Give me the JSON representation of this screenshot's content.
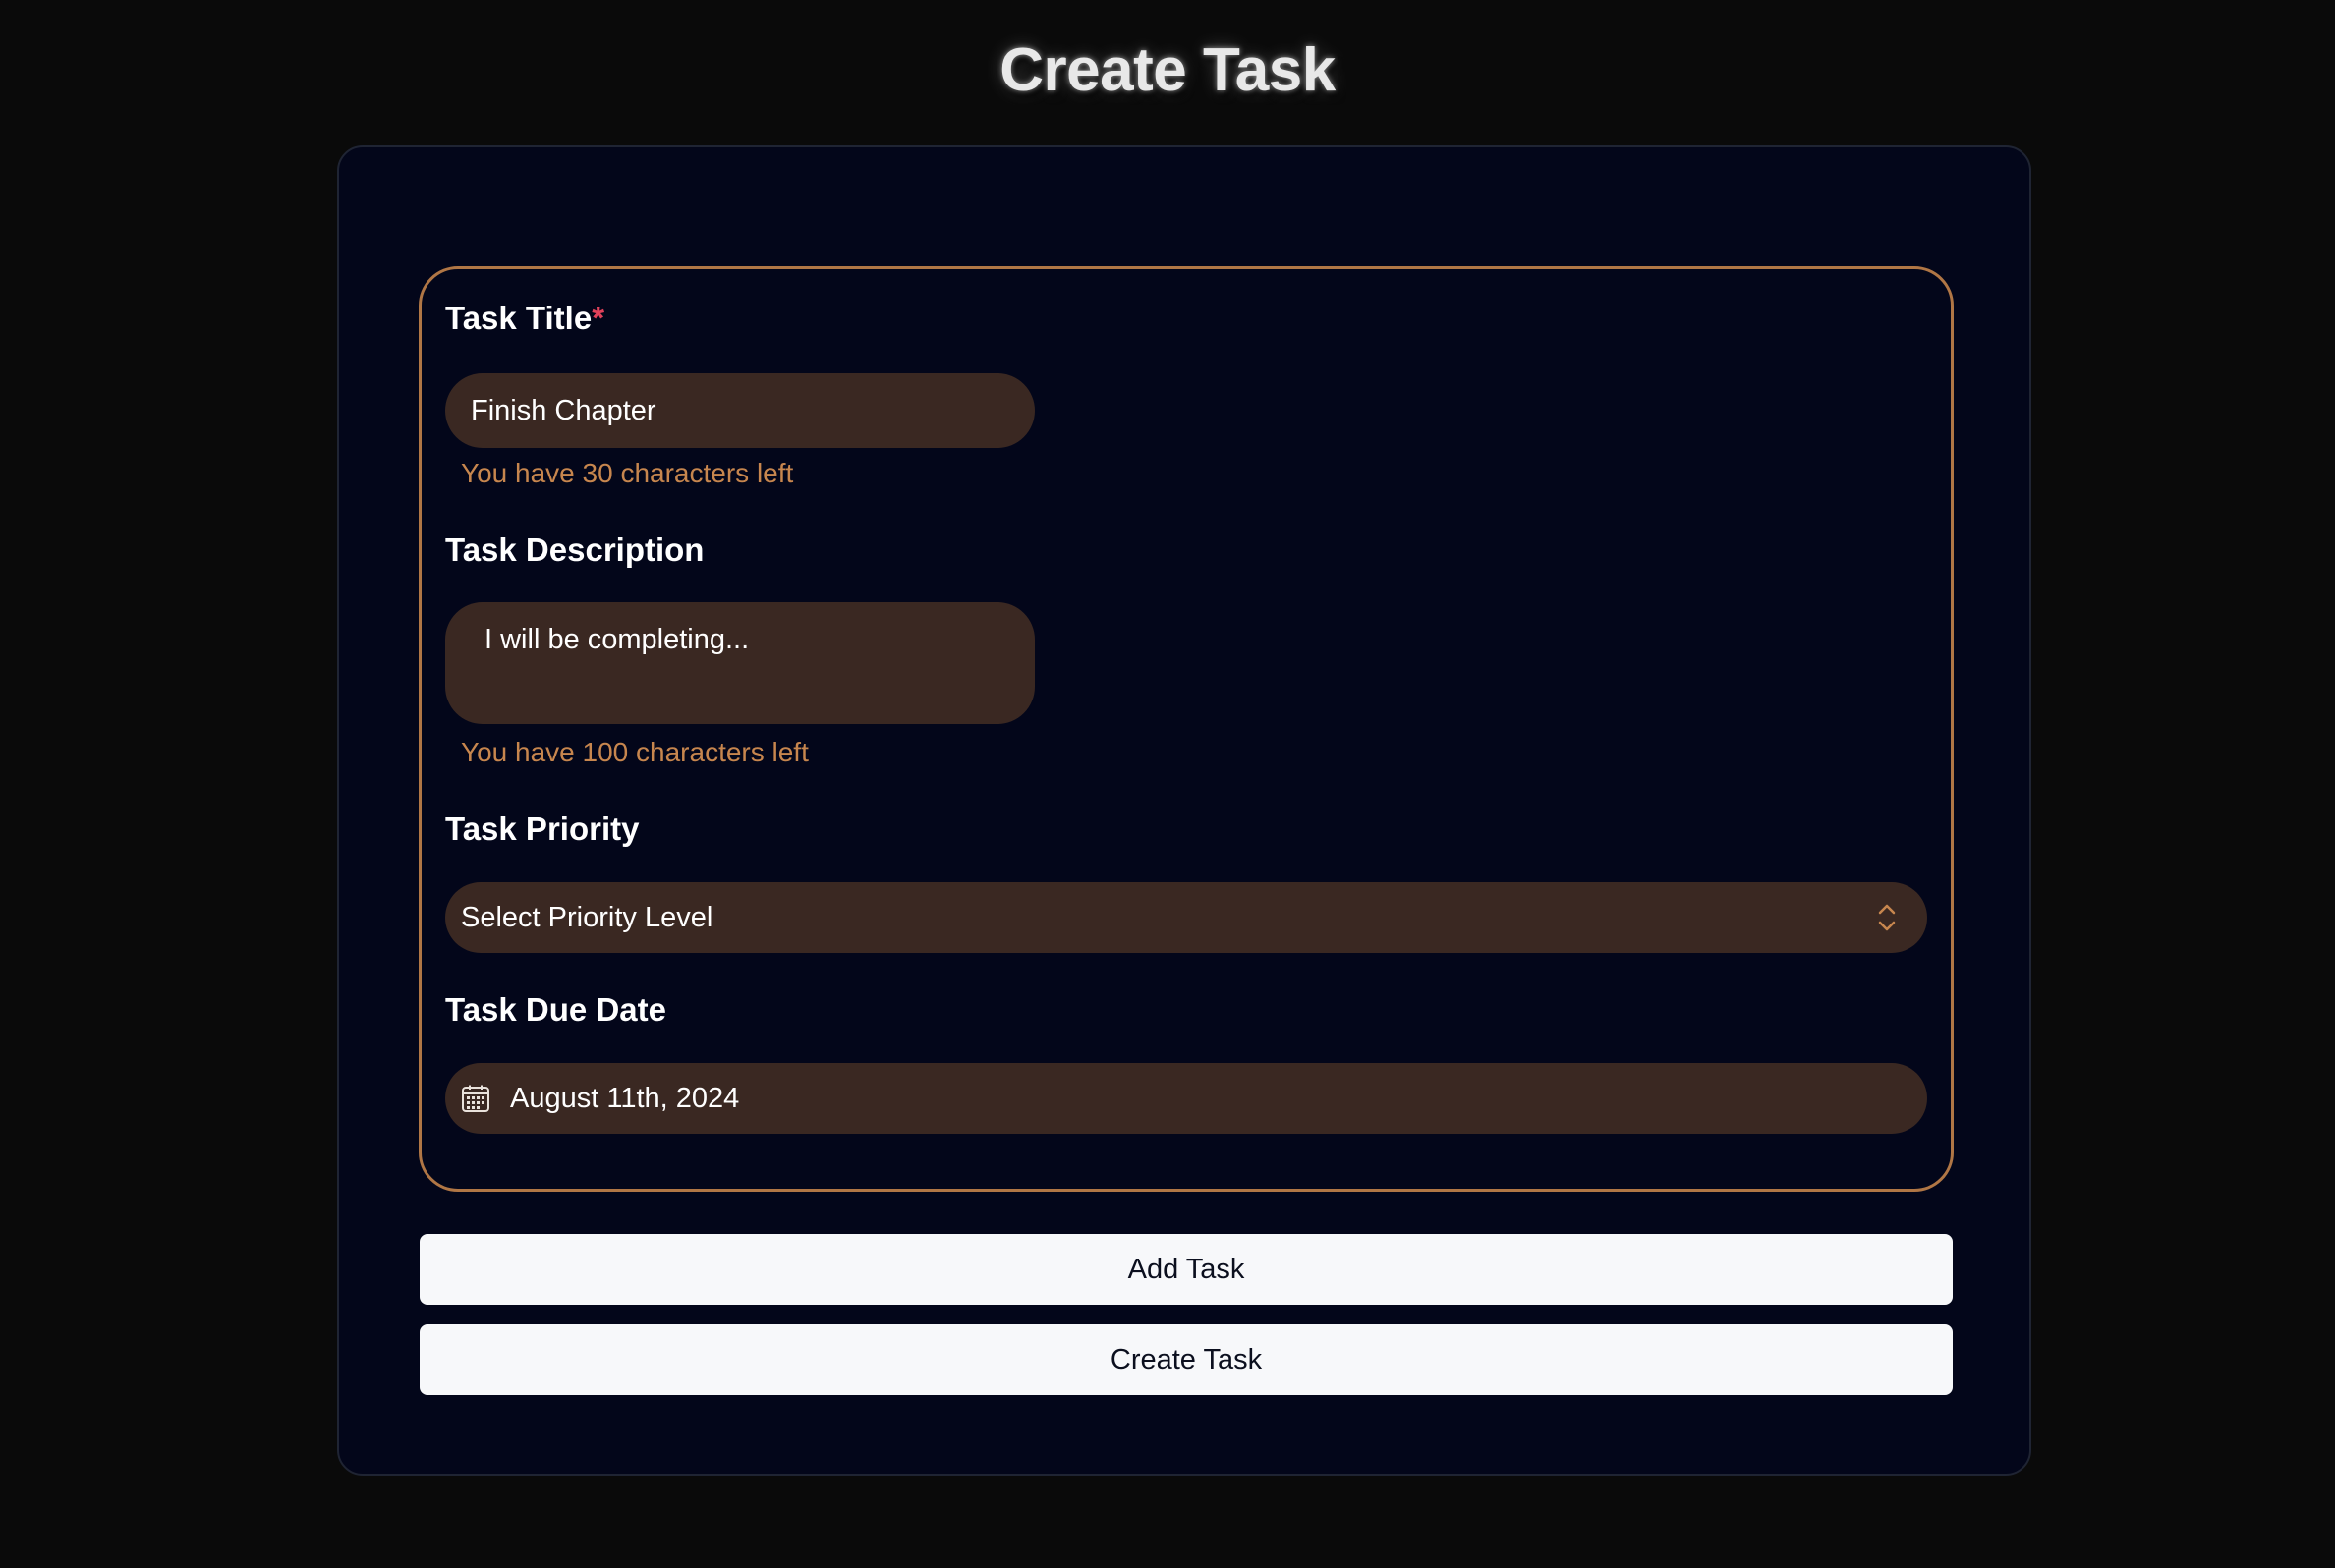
{
  "page": {
    "title": "Create Task"
  },
  "form": {
    "title_field": {
      "label": "Task Title",
      "required_mark": "*",
      "value": "Finish Chapter",
      "helper": "You have 30 characters left"
    },
    "description_field": {
      "label": "Task Description",
      "value": "I will be completing...",
      "helper": "You have 100 characters left"
    },
    "priority_field": {
      "label": "Task Priority",
      "selected": "Select Priority Level",
      "icon": "chevron-up-down-icon"
    },
    "due_date_field": {
      "label": "Task Due Date",
      "value": "August 11th, 2024",
      "icon": "calendar-icon"
    }
  },
  "actions": {
    "add_label": "Add Task",
    "create_label": "Create Task"
  },
  "colors": {
    "background": "#0a0a0a",
    "card": "#03061a",
    "accent": "#b07645",
    "helper_text": "#c7864e",
    "field": "#3a2822",
    "required": "#e0415a",
    "button": "#f7f8fa"
  }
}
